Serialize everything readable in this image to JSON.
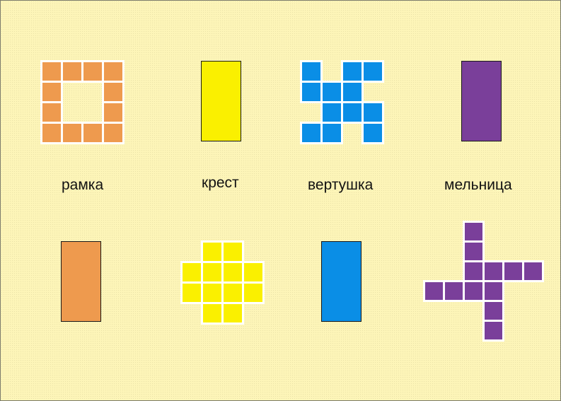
{
  "labels": {
    "ramka": "рамка",
    "krest": "крест",
    "vertushka": "вертушка",
    "melnitsa": "мельница"
  },
  "colors": {
    "background": "#fdf5b8",
    "orange": "#ee9a4e",
    "yellow": "#faf000",
    "blue": "#0a8ee6",
    "purple": "#7a3f9a"
  },
  "figures": {
    "ramka": {
      "color_key": "orange",
      "cells": [
        [
          0,
          0
        ],
        [
          1,
          0
        ],
        [
          2,
          0
        ],
        [
          3,
          0
        ],
        [
          0,
          1
        ],
        [
          3,
          1
        ],
        [
          0,
          2
        ],
        [
          3,
          2
        ],
        [
          0,
          3
        ],
        [
          1,
          3
        ],
        [
          2,
          3
        ],
        [
          3,
          3
        ]
      ]
    },
    "vertushka": {
      "color_key": "blue",
      "cells": [
        [
          0,
          0
        ],
        [
          2,
          0
        ],
        [
          3,
          0
        ],
        [
          0,
          1
        ],
        [
          1,
          1
        ],
        [
          2,
          1
        ],
        [
          1,
          2
        ],
        [
          2,
          2
        ],
        [
          3,
          2
        ],
        [
          0,
          3
        ],
        [
          1,
          3
        ],
        [
          3,
          3
        ]
      ]
    },
    "krest": {
      "color_key": "yellow",
      "cells": [
        [
          1,
          0
        ],
        [
          2,
          0
        ],
        [
          0,
          1
        ],
        [
          1,
          1
        ],
        [
          2,
          1
        ],
        [
          3,
          1
        ],
        [
          0,
          2
        ],
        [
          1,
          2
        ],
        [
          2,
          2
        ],
        [
          3,
          2
        ],
        [
          1,
          3
        ],
        [
          2,
          3
        ]
      ]
    },
    "melnitsa": {
      "color_key": "purple",
      "cells": [
        [
          2,
          0
        ],
        [
          2,
          1
        ],
        [
          2,
          2
        ],
        [
          3,
          2
        ],
        [
          4,
          2
        ],
        [
          5,
          2
        ],
        [
          0,
          3
        ],
        [
          1,
          3
        ],
        [
          2,
          3
        ],
        [
          3,
          3
        ],
        [
          3,
          4
        ],
        [
          3,
          5
        ]
      ]
    }
  }
}
